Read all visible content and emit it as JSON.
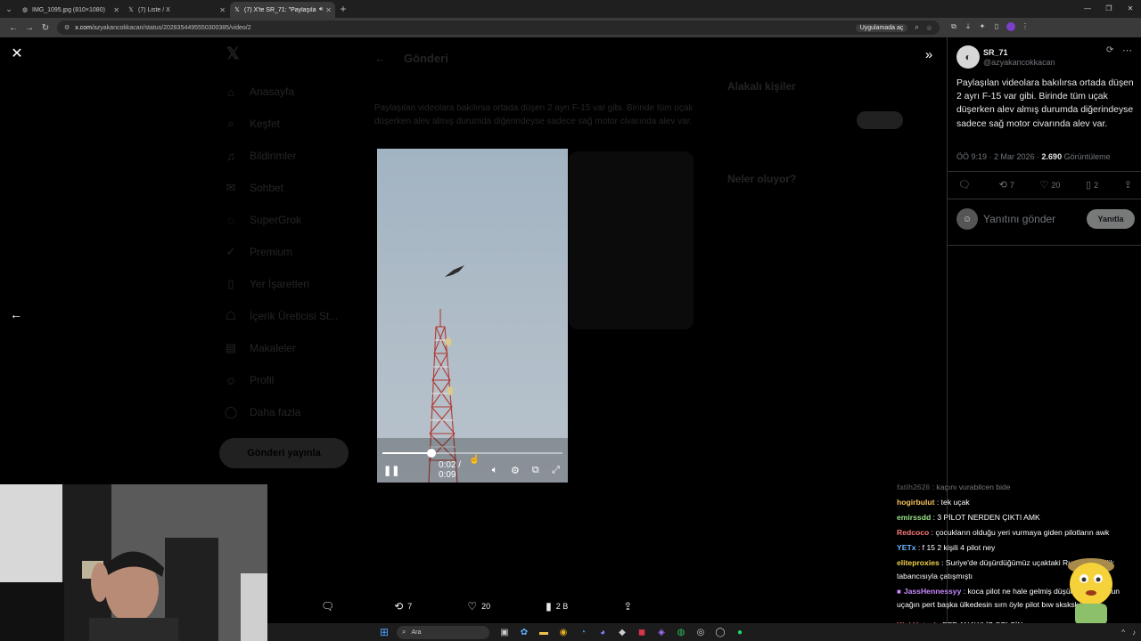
{
  "browser": {
    "tabs": [
      {
        "label": "IMG_1095.jpg (810×1080)",
        "icon": "image-favicon",
        "active": false
      },
      {
        "label": "(7) Liste / X",
        "icon": "x-favicon",
        "active": false
      },
      {
        "label": "(7) X'te SR_71: \"Paylaşılan v",
        "icon": "x-favicon",
        "active": true
      }
    ],
    "url_host": "x.com",
    "url_path": "/azyakancokkacan/status/2028354495550300385/video/2",
    "open_in_app": "Uygulamada aç"
  },
  "background": {
    "nav_items": [
      "Anasayfa",
      "Keşfet",
      "Bildirimler",
      "Sohbet",
      "SuperGrok",
      "Premium",
      "Yer İşaretleri",
      "İçerik Üreticisi St...",
      "Makaleler",
      "Profil",
      "Daha fazla"
    ],
    "post_button": "Gönderi yayınla",
    "center_header": "Gönderi",
    "right_title_1": "Alakalı kişiler",
    "right_title_2": "Neler oluyor?"
  },
  "video": {
    "current_time": "0:02",
    "separator": "/",
    "total_time": "0:09",
    "progress": 0.27
  },
  "action_bar": {
    "retweets": "7",
    "likes": "20",
    "views": "2 B"
  },
  "tweet": {
    "display_name": "SR_71",
    "handle": "@azyakancokkacan",
    "text": "Paylaşılan videolara bakılırsa ortada düşen 2 ayrı F-15 var gibi. Birinde tüm uçak düşerken alev almış durumda diğerindeyse sadece sağ motor civarında alev var.",
    "time": "ÖÖ 9:19 · 2 Mar 2026 · ",
    "views_count": "2.690",
    "views_label": " Görüntüleme",
    "retweets": "7",
    "likes": "20",
    "bookmarks": "2",
    "reply_placeholder": "Yanıtını gönder",
    "reply_button": "Yanıtla"
  },
  "chat": [
    {
      "user": "fatih2626",
      "text": " : kaçını vurabilcen bide",
      "color": "#9a9a9a",
      "faded": true
    },
    {
      "user": "hogirbulut",
      "text": " : tek uçak",
      "color": "#f6c35b"
    },
    {
      "user": "emirssdd",
      "text": " : 3 PİLOT NERDEN ÇIKTI AMK",
      "color": "#9be38a"
    },
    {
      "user": "Redcoco",
      "text": " : çocukların olduğu yeri vurmaya giden pilotların awk",
      "color": "#ff7a7a"
    },
    {
      "user": "YETx",
      "text": " : f 15 2 kişili 4 pilot ney",
      "color": "#6fb7ff"
    },
    {
      "user": "eliteproxies",
      "text": " : Suriye'de düşürdüğümüz uçaktaki Rus pilot beylik tabancısıyla çatışmıştı",
      "color": "#f0d04a"
    },
    {
      "user": "JassHennessyy",
      "text": " : koca pilot ne hale gelmiş düşünsene pilotsun uçağın pert başka ülkedesin sırn öyle pilot bıw sksksksksksk",
      "color": "#c98bff",
      "badge": true
    },
    {
      "user": "KickUstasi",
      "text": " : EFE ANAWLİZ GELSİN",
      "color": "#ff6a6a"
    }
  ],
  "taskbar": {
    "search_label": "Ara"
  }
}
